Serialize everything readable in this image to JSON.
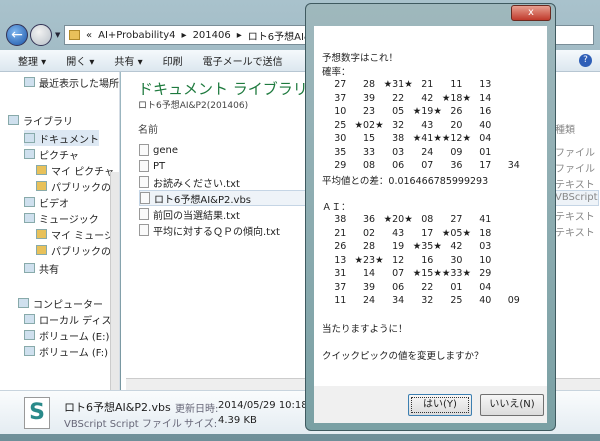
{
  "explorer": {
    "breadcrumb": [
      "«",
      "AI+Probability4",
      "201406",
      "ロト6予想AI&P2(201406)"
    ],
    "toolbar": [
      "整理 ▾",
      "開く ▾",
      "共有 ▾",
      "印刷",
      "電子メールで送信"
    ],
    "nav": [
      {
        "label": "最近表示した場所",
        "icon": "recent-places-icon"
      },
      {
        "label": "ライブラリ",
        "icon": "library-icon"
      },
      {
        "label": "ドキュメント",
        "icon": "documents-icon"
      },
      {
        "label": "ピクチャ",
        "icon": "pictures-icon"
      },
      {
        "label": "マイ ピクチャ",
        "icon": "folder-icon"
      },
      {
        "label": "パブリックのピクチャ",
        "icon": "folder-icon"
      },
      {
        "label": "ビデオ",
        "icon": "video-icon"
      },
      {
        "label": "ミュージック",
        "icon": "music-icon"
      },
      {
        "label": "マイ ミュージック",
        "icon": "folder-icon"
      },
      {
        "label": "パブリックのミュージック",
        "icon": "folder-icon"
      },
      {
        "label": "共有",
        "icon": "share-icon"
      },
      {
        "label": "コンピューター",
        "icon": "computer-icon"
      },
      {
        "label": "ローカル ディスク",
        "icon": "disk-icon"
      },
      {
        "label": "ボリューム (E:)",
        "icon": "drive-icon"
      },
      {
        "label": "ボリューム (F:)",
        "icon": "drive-icon"
      }
    ],
    "library_title": "ドキュメント ライブラリ",
    "library_sub": "ロト6予想AI&P2(201406)",
    "column_name": "名前",
    "column_type": "種類",
    "files": [
      {
        "name": "gene",
        "type": "ファイル"
      },
      {
        "name": "PT",
        "type": "ファイル"
      },
      {
        "name": "お読みください.txt",
        "type": "テキスト"
      },
      {
        "name": "ロト6予想AI&P2.vbs",
        "type": "VBScript S"
      },
      {
        "name": "前回の当選結果.txt",
        "type": "テキスト"
      },
      {
        "name": "平均に対するＱＰの傾向.txt",
        "type": "テキスト"
      }
    ],
    "status": {
      "name": "ロト6予想AI&P2.vbs",
      "type": "VBScript Script ファイル",
      "modified_label": "更新日時:",
      "modified": "2014/05/29 10:18",
      "size_label": "サイズ:",
      "size": "4.39 KB"
    }
  },
  "dialog": {
    "close": "x",
    "header": "予想数字はこれ！",
    "prob_label": "確率：",
    "prob_rows": [
      [
        "27",
        "28",
        "★31★",
        "21",
        "11",
        "13"
      ],
      [
        "37",
        "39",
        "22",
        "42",
        "★18★",
        "14"
      ],
      [
        "10",
        "23",
        "05",
        "★19★",
        "26",
        "16"
      ],
      [
        "25",
        "★02★",
        "32",
        "43",
        "20",
        "40"
      ],
      [
        "30",
        "15",
        "38",
        "★41★",
        "★12★",
        "04"
      ],
      [
        "35",
        "33",
        "03",
        "24",
        "09",
        "01"
      ],
      [
        "29",
        "08",
        "06",
        "07",
        "36",
        "17",
        "34"
      ]
    ],
    "avg_diff": "平均値との差：0.016466785999293",
    "ai_label": "ＡＩ：",
    "ai_rows": [
      [
        "38",
        "36",
        "★20★",
        "08",
        "27",
        "41"
      ],
      [
        "21",
        "02",
        "43",
        "17",
        "★05★",
        "18"
      ],
      [
        "26",
        "28",
        "19",
        "★35★",
        "42",
        "03"
      ],
      [
        "13",
        "★23★",
        "12",
        "16",
        "30",
        "10"
      ],
      [
        "31",
        "14",
        "07",
        "★15★",
        "★33★",
        "29"
      ],
      [
        "37",
        "39",
        "06",
        "22",
        "01",
        "04"
      ],
      [
        "11",
        "24",
        "34",
        "32",
        "25",
        "40",
        "09"
      ]
    ],
    "wish": "当たりますように！",
    "question": "クイックピックの値を変更しますか？",
    "yes": "はい(Y)",
    "no": "いいえ(N)"
  }
}
